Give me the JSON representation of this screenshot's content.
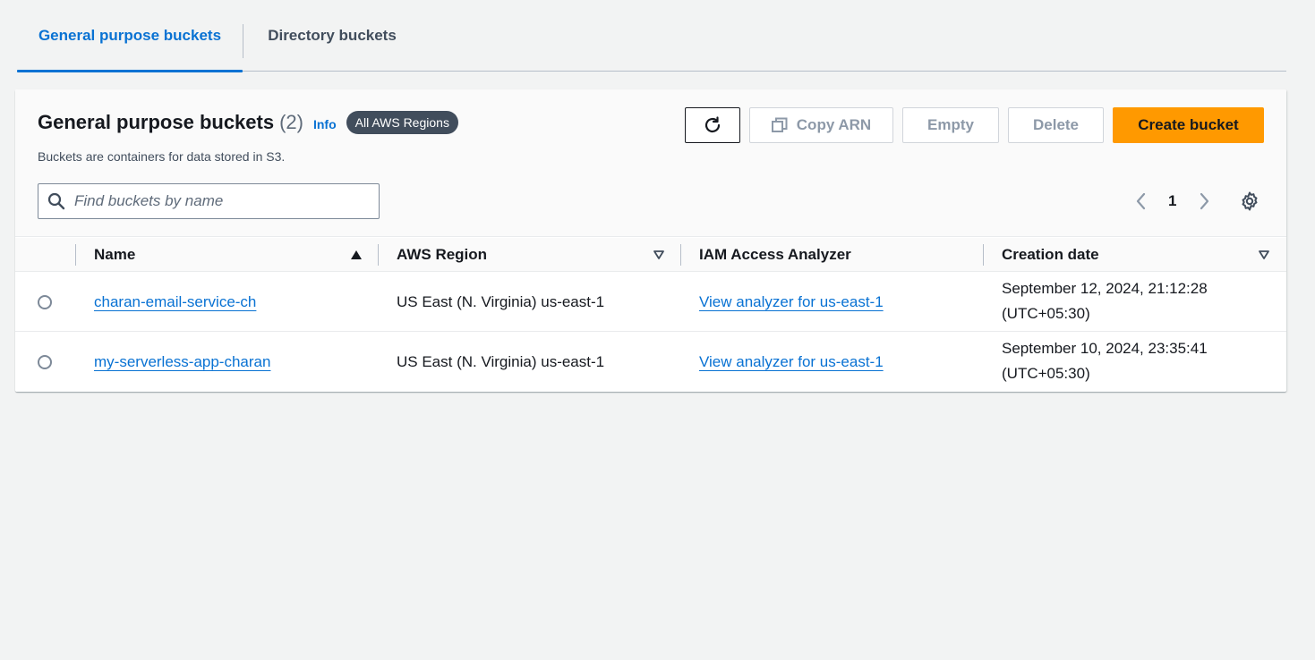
{
  "tabs": [
    {
      "label": "General purpose buckets",
      "active": true
    },
    {
      "label": "Directory buckets",
      "active": false
    }
  ],
  "panel": {
    "title": "General purpose buckets",
    "count": "(2)",
    "info_label": "Info",
    "region_badge": "All AWS Regions",
    "description": "Buckets are containers for data stored in S3.",
    "buttons": {
      "refresh_icon": "refresh-icon",
      "copy_arn": "Copy ARN",
      "empty": "Empty",
      "delete": "Delete",
      "create": "Create bucket"
    },
    "search": {
      "placeholder": "Find buckets by name",
      "value": ""
    },
    "pagination": {
      "current_page": "1"
    }
  },
  "table": {
    "columns": [
      "Name",
      "AWS Region",
      "IAM Access Analyzer",
      "Creation date"
    ],
    "rows": [
      {
        "name": "charan-email-service-ch",
        "region": "US East (N. Virginia) us-east-1",
        "analyzer": "View analyzer for us-east-1",
        "created_line1": "September 12, 2024, 21:12:28",
        "created_line2": "(UTC+05:30)"
      },
      {
        "name": "my-serverless-app-charan",
        "region": "US East (N. Virginia) us-east-1",
        "analyzer": "View analyzer for us-east-1",
        "created_line1": "September 10, 2024, 23:35:41",
        "created_line2": "(UTC+05:30)"
      }
    ]
  },
  "colors": {
    "accent": "#0972d3",
    "primary_button": "#ff9900",
    "badge": "#414d5c",
    "background": "#f2f3f3"
  }
}
